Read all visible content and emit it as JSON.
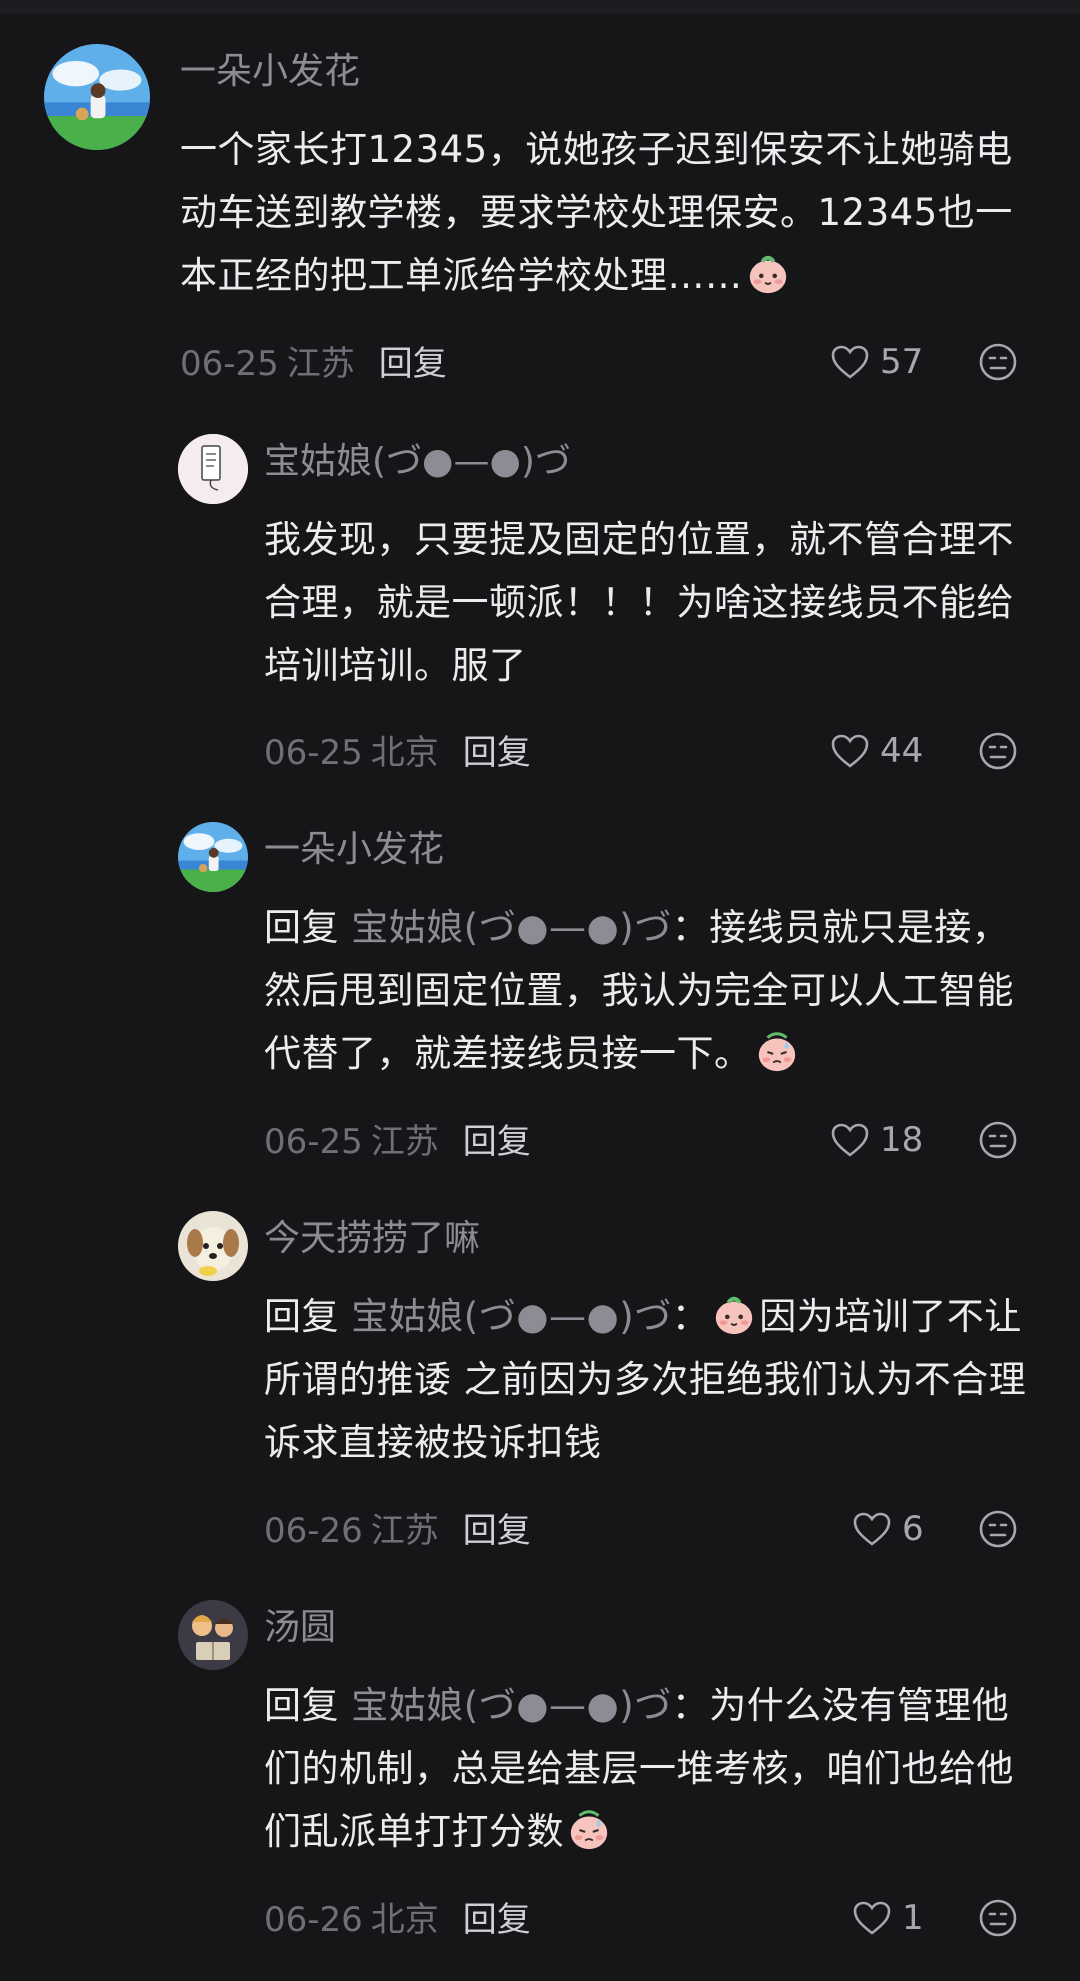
{
  "colors": {
    "background": "#161619",
    "text": "#ececee",
    "username": "#8c8c94",
    "meta": "#6f6f77"
  },
  "comments": [
    {
      "username": "一朵小发花",
      "avatar": "landscape-avatar",
      "text_before_emoji": "一个家长打12345，说她孩子迟到保安不让她骑电动车送到教学楼，要求学校处理保安。12345也一本正经的把工单派给学校处理……",
      "emoji": "peach-face-emoji",
      "date": "06-25",
      "location": "江苏",
      "reply_label": "回复",
      "likes": "57"
    },
    {
      "username": "宝姑娘(づ●—●)づ",
      "avatar": "paper-avatar",
      "text": "我发现，只要提及固定的位置，就不管合理不合理，就是一顿派！！！为啥这接线员不能给培训培训。服了",
      "date": "06-25",
      "location": "北京",
      "reply_label": "回复",
      "likes": "44"
    },
    {
      "username": "一朵小发花",
      "avatar": "landscape-avatar",
      "reply_prefix": "回复",
      "reply_target": "宝姑娘(づ●—●)づ",
      "text_before_emoji": "：接线员就只是接，然后甩到固定位置，我认为完全可以人工智能代替了，就差接线员接一下。",
      "emoji": "sweat-face-emoji",
      "date": "06-25",
      "location": "江苏",
      "reply_label": "回复",
      "likes": "18"
    },
    {
      "username": "今天捞捞了嘛",
      "avatar": "dog-avatar",
      "reply_prefix": "回复",
      "reply_target": "宝姑娘(づ●—●)づ",
      "colon": "：",
      "emoji": "peach-face-emoji",
      "text_after_emoji": "因为培训了不让所谓的推诿 之前因为多次拒绝我们认为不合理诉求直接被投诉扣钱",
      "date": "06-26",
      "location": "江苏",
      "reply_label": "回复",
      "likes": "6"
    },
    {
      "username": "汤圆",
      "avatar": "children-reading-avatar",
      "reply_prefix": "回复",
      "reply_target": "宝姑娘(づ●—●)づ",
      "text_before_emoji": "：为什么没有管理他们的机制，总是给基层一堆考核，咱们也给他们乱派单打打分数",
      "emoji": "sweat-face-emoji",
      "date": "06-26",
      "location": "北京",
      "reply_label": "回复",
      "likes": "1"
    }
  ]
}
